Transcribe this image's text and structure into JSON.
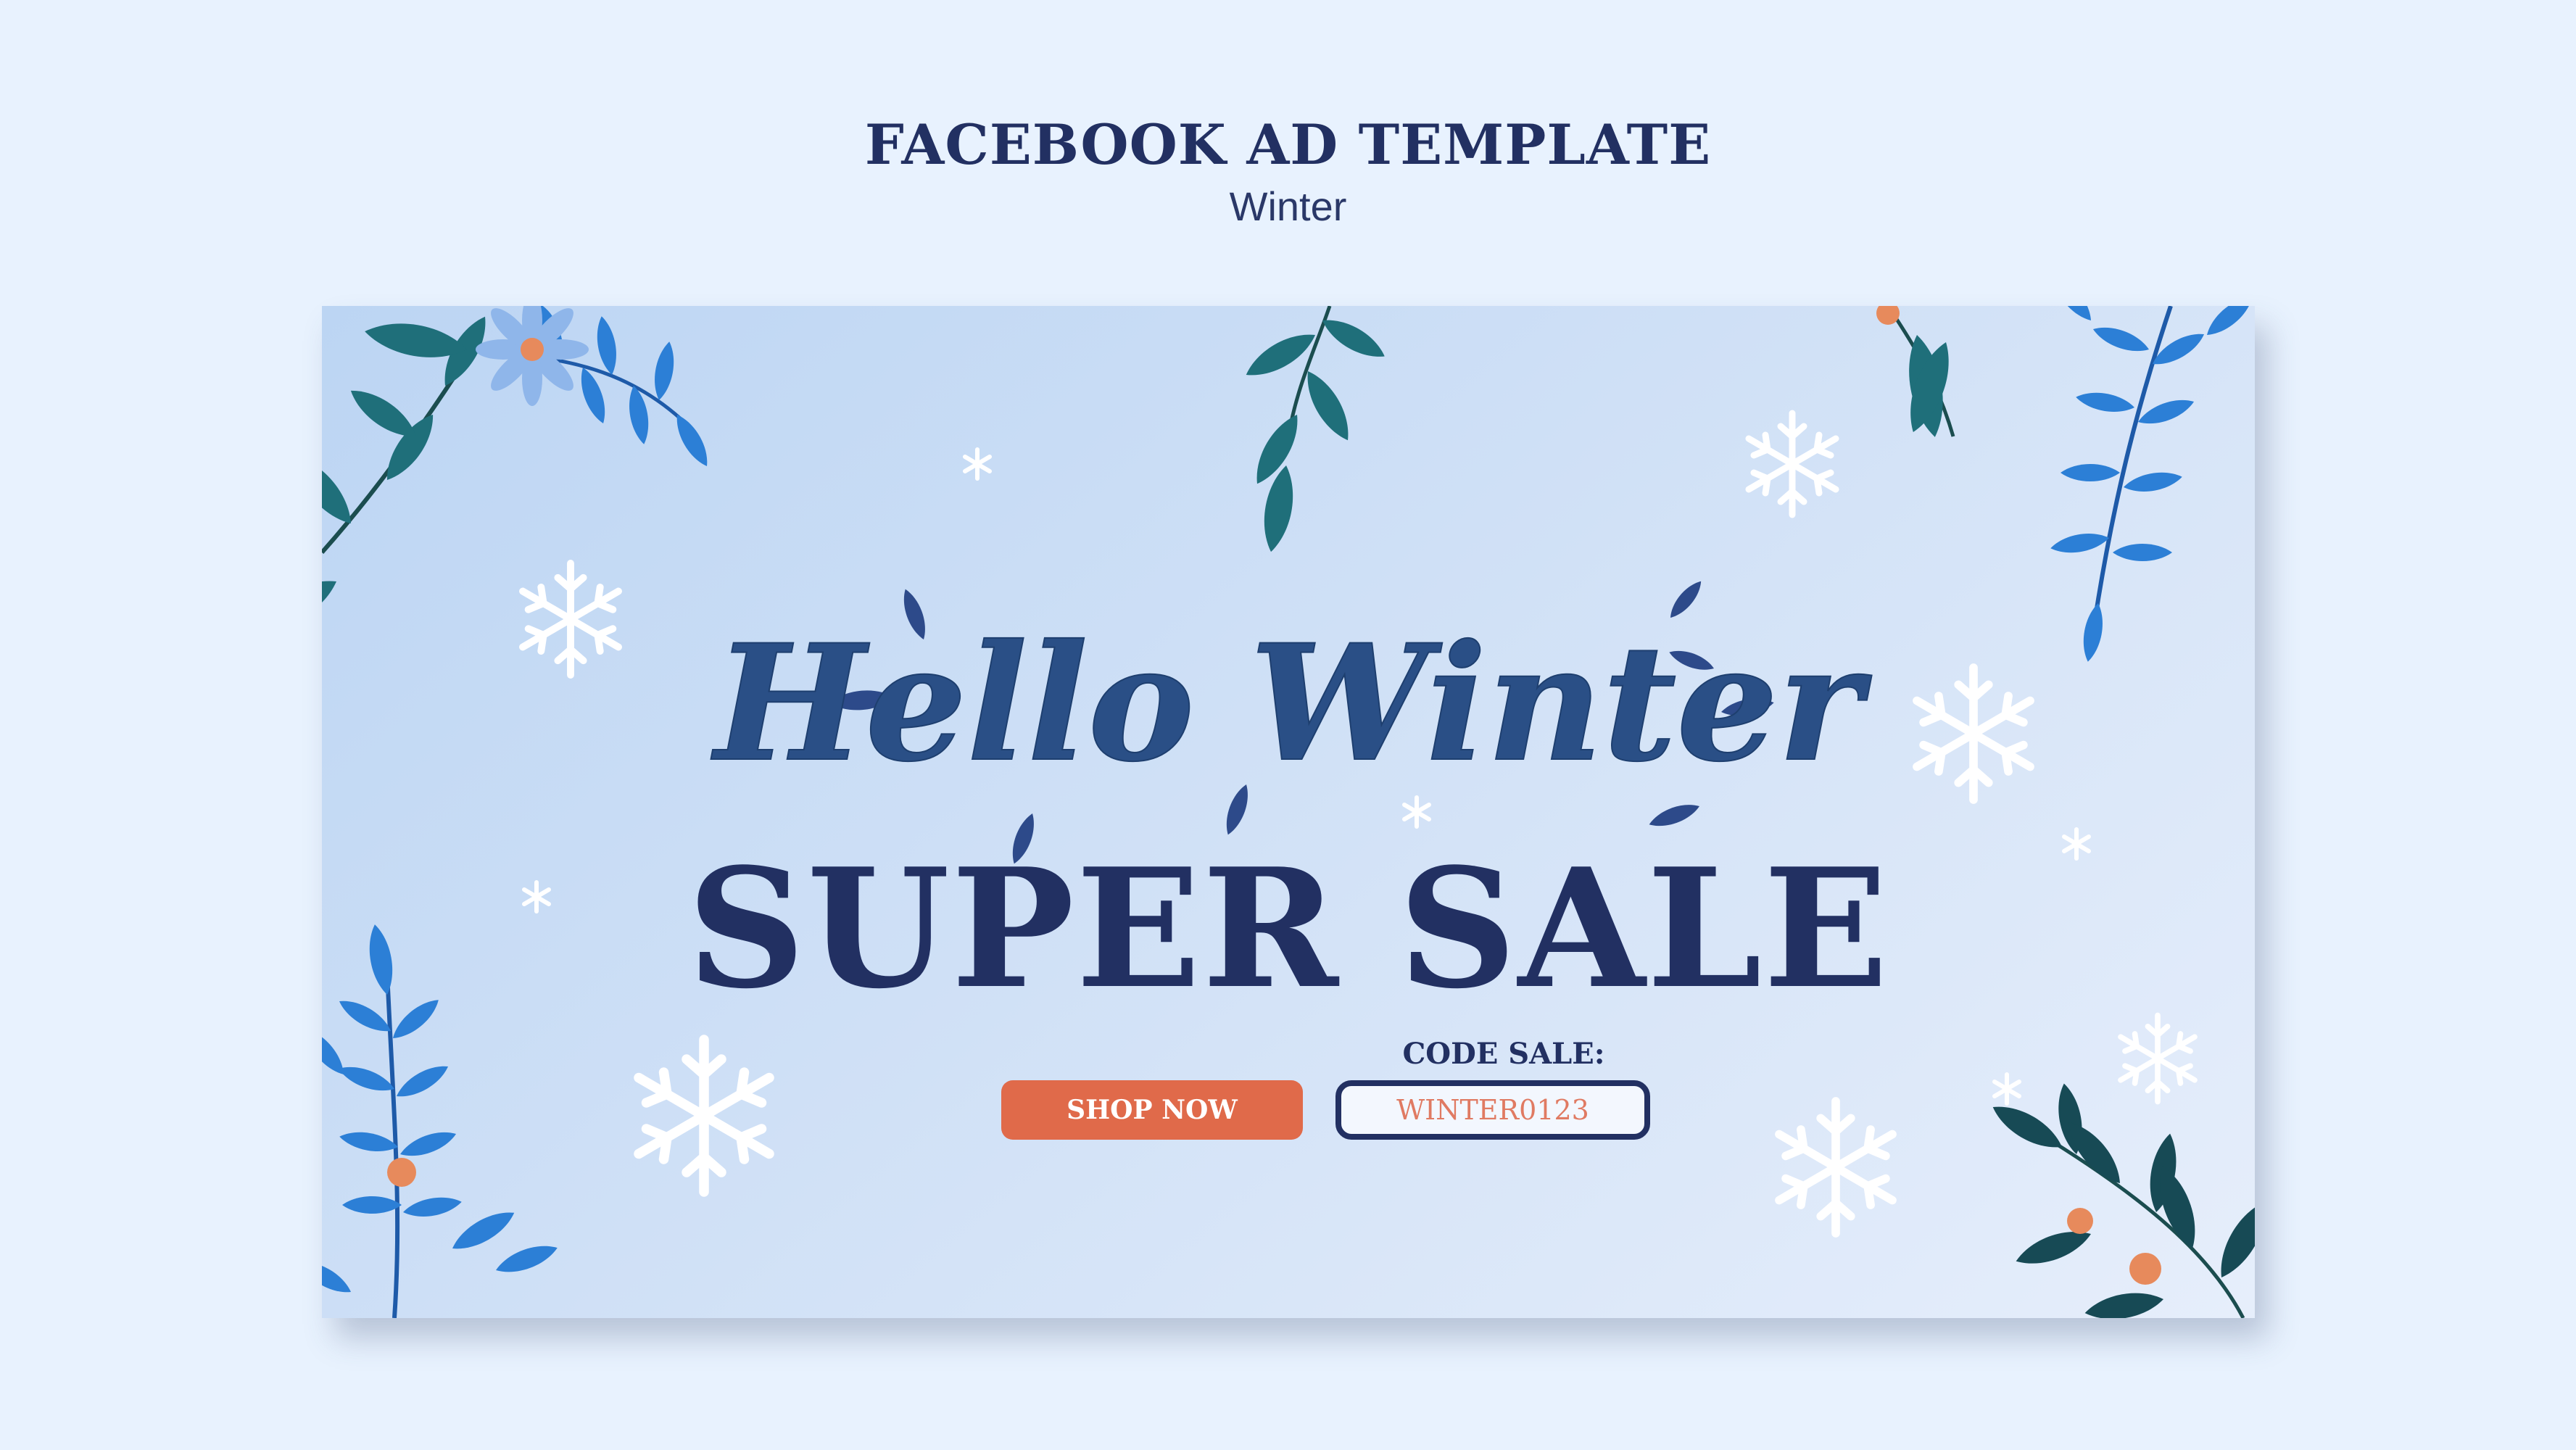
{
  "header": {
    "title": "FACEBOOK AD TEMPLATE",
    "subtitle": "Winter"
  },
  "ad": {
    "script_headline": "Hello Winter",
    "headline": "SUPER SALE",
    "code_label": "CODE SALE:",
    "shop_button_label": "SHOP NOW",
    "code_value": "WINTER0123"
  },
  "colors": {
    "page_background": "#e8f2fe",
    "navy": "#223062",
    "accent_orange": "#e06a4a",
    "leaf_teal": "#1f6f7a",
    "leaf_blue": "#2c7fd6"
  },
  "icons": [
    "snowflake-icon",
    "sparkle-icon",
    "leaf-branch-icon",
    "flower-icon"
  ]
}
